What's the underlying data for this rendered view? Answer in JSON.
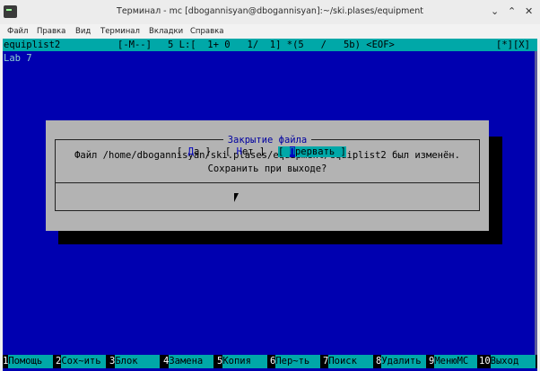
{
  "window": {
    "title": "Терминал - mc [dbogannisyan@dbogannisyan]:~/ski.plases/equipment",
    "controls": {
      "minimize": "⌄",
      "maximize": "⌃",
      "close": "✕"
    }
  },
  "menubar": [
    "Файл",
    "Правка",
    "Вид",
    "Терминал",
    "Вкладки",
    "Справка"
  ],
  "editor": {
    "filename": "equiplist2",
    "mode": "[-M--]",
    "pos": "5 L:[  1+ 0   1/  1] *(5   /   5b) <EOF>",
    "flags": "[*][X]",
    "lines": [
      "Lab 7"
    ]
  },
  "dialog": {
    "title": "Закрытие файла",
    "message_line1": "Файл /home/dbogannisyan/ski.plases/equipment/equiplist2 был изменён.",
    "message_line2": "Сохранить при выходе?",
    "buttons": [
      {
        "pre": "[ ",
        "hotkey": "Д",
        "rest": "а ]",
        "active": false
      },
      {
        "pre": "[ ",
        "hotkey": "Н",
        "rest": "ет ]",
        "active": false
      },
      {
        "pre": "[ ",
        "hotkey": "П",
        "rest": "рервать ]",
        "active": true
      }
    ]
  },
  "fkeys": [
    {
      "num": "1",
      "label": "Помощь"
    },
    {
      "num": "2",
      "label": "Сох~ить"
    },
    {
      "num": "3",
      "label": "Блок"
    },
    {
      "num": "4",
      "label": "Замена"
    },
    {
      "num": "5",
      "label": "Копия"
    },
    {
      "num": "6",
      "label": "Пер~ть"
    },
    {
      "num": "7",
      "label": "Поиск"
    },
    {
      "num": "8",
      "label": "Удалить"
    },
    {
      "num": "9",
      "label": "МенюMC"
    },
    {
      "num": "10",
      "label": "Выход"
    }
  ],
  "colors": {
    "terminal_bg": "#0000b0",
    "status_bg": "#00a8a8",
    "dialog_bg": "#b3b3b3"
  }
}
